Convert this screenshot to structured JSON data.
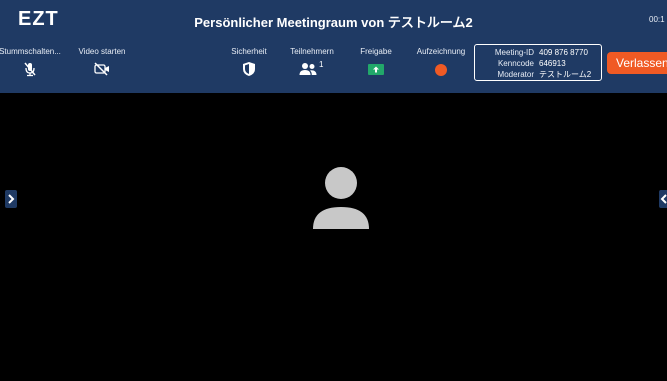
{
  "app": {
    "logo": "EZT",
    "room_title": "Persönlicher Meetingraum von テストルーム2",
    "clock": "00:1"
  },
  "toolbar": {
    "mute_label": "Stummschalten...",
    "video_label": "Video starten",
    "security_label": "Sicherheit",
    "participants_label": "Teilnehmern",
    "participants_count": "1",
    "share_label": "Freigabe",
    "record_label": "Aufzeichnung",
    "leave_label": "Verlassen"
  },
  "meeting_info": {
    "id_key": "Meeting-ID",
    "id_value": "409 876 8770",
    "passcode_key": "Kenncode",
    "passcode_value": "646913",
    "host_key": "Moderator",
    "host_value": "テストルーム2"
  },
  "colors": {
    "toolbar_bg": "#1f3a64",
    "leave_button": "#f05a24",
    "record_dot": "#f05a24",
    "share_green": "#22a86a",
    "avatar_gray": "#c8c8c8"
  },
  "icons": {
    "mute": "microphone-muted-icon",
    "video": "camera-off-icon",
    "security": "shield-icon",
    "participants": "people-icon",
    "share": "share-screen-icon",
    "record": "record-dot-icon",
    "avatar": "user-avatar-icon",
    "left_tab": "chevron-right-icon",
    "right_tab": "chevron-left-icon"
  }
}
